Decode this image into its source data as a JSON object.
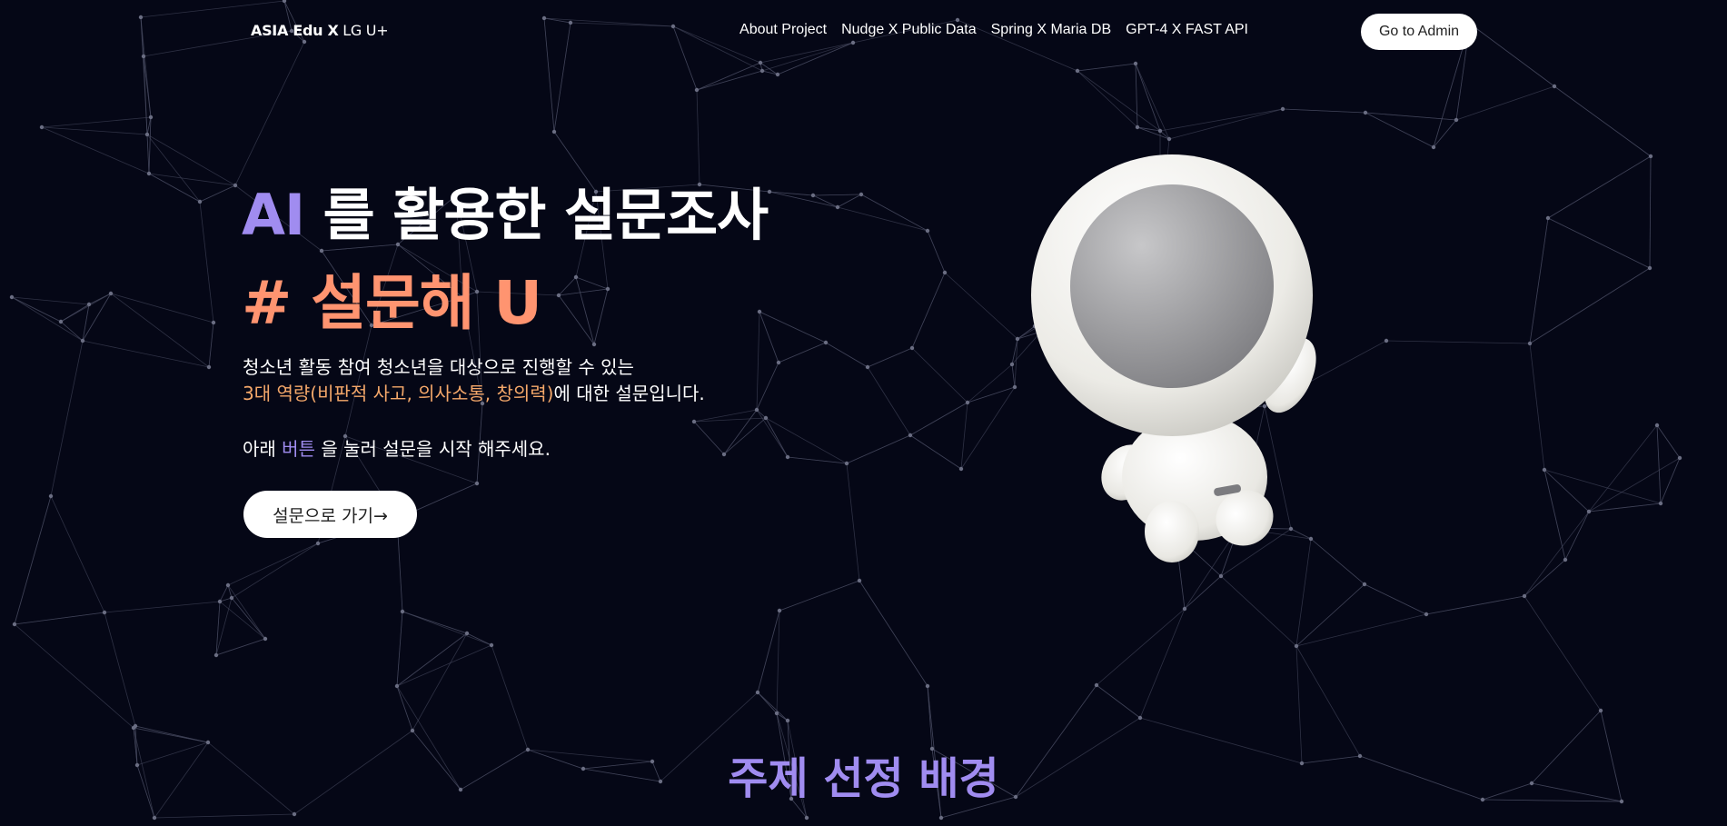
{
  "nav": {
    "brand_bold": "ASIA Edu X",
    "brand_light": "LG U+",
    "links": [
      "About Project",
      "Nudge X Public Data",
      "Spring X Maria DB",
      "GPT-4 X FAST API"
    ],
    "admin_button": "Go to Admin"
  },
  "hero": {
    "title_ai": "AI",
    "title_rest": "를 활용한 설문조사",
    "subtitle": "# 설문해 U",
    "desc_line1": "청소년 활동 참여 청소년을 대상으로 진행할 수 있는",
    "desc_highlight": "3대 역량(비판적 사고, 의사소통, 창의력)",
    "desc_line2_rest": "에 대한 설문입니다.",
    "prompt_before": "아래",
    "prompt_highlight": "버튼",
    "prompt_after": "을 눌러 설문을 시작 해주세요.",
    "start_button": "설문으로 가기→"
  },
  "section": {
    "title": "주제 선정 배경"
  },
  "colors": {
    "background": "#050716",
    "accent_purple": "#a08cf0",
    "accent_orange": "#ff9470",
    "highlight_orange": "#f5a86a"
  },
  "icons": {
    "mascot": "astronaut-mascot-illustration"
  }
}
